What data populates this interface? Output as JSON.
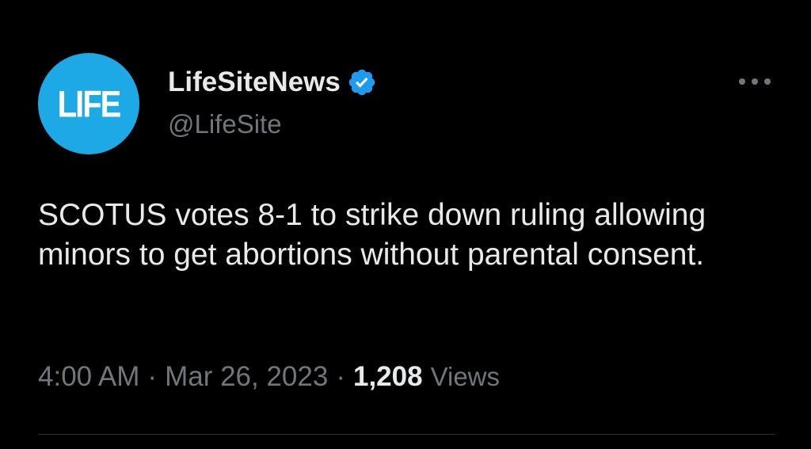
{
  "author": {
    "avatar_text": "LIFE",
    "display_name": "LifeSiteNews",
    "handle": "@LifeSite",
    "verified": true,
    "avatar_color": "#1da9e6",
    "verified_color": "#1d9bf0"
  },
  "tweet": {
    "text": "SCOTUS votes 8-1 to strike down ruling allowing minors to get abortions without parental consent.",
    "time": "4:00 AM",
    "separator": "·",
    "date": "Mar 26, 2023",
    "views_count": "1,208",
    "views_label": "Views"
  },
  "icons": {
    "more": "more-horizontal-icon",
    "verified": "verified-badge-icon"
  }
}
